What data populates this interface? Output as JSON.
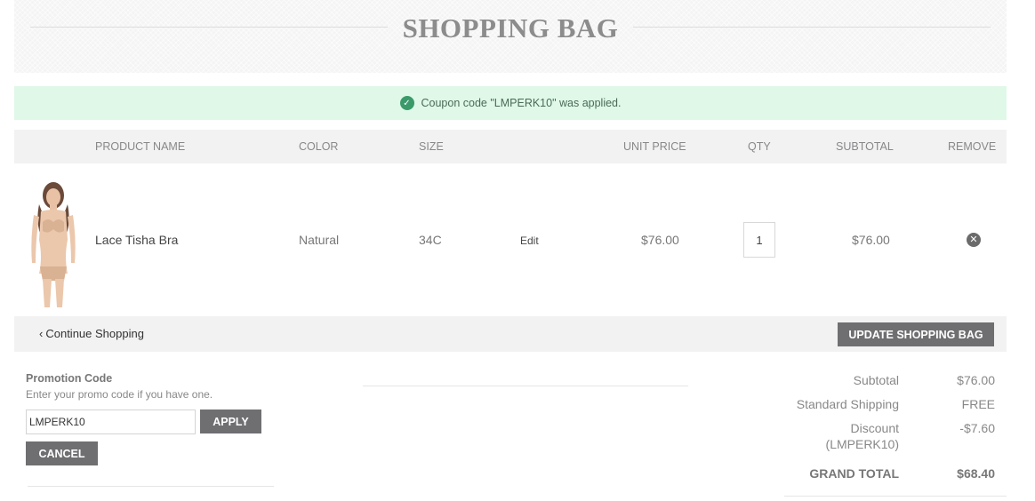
{
  "header": {
    "title": "SHOPPING BAG"
  },
  "notice": {
    "icon": "check-circle-icon",
    "text": "Coupon code \"LMPERK10\" was applied."
  },
  "table": {
    "columns": [
      "PRODUCT NAME",
      "COLOR",
      "SIZE",
      "UNIT PRICE",
      "QTY",
      "SUBTOTAL",
      "REMOVE"
    ],
    "items": [
      {
        "name": "Lace Tisha Bra",
        "color": "Natural",
        "size": "34C",
        "edit_label": "Edit",
        "unit_price": "$76.00",
        "qty": "1",
        "subtotal": "$76.00",
        "remove_icon": "close-circle-icon"
      }
    ]
  },
  "actions": {
    "continue_label": "Continue Shopping",
    "update_label": "UPDATE SHOPPING BAG"
  },
  "promo": {
    "title": "Promotion Code",
    "hint": "Enter your promo code if you have one.",
    "code_value": "LMPERK10",
    "apply_label": "APPLY",
    "cancel_label": "CANCEL"
  },
  "totals": {
    "subtotal_label": "Subtotal",
    "subtotal_value": "$76.00",
    "shipping_label": "Standard Shipping",
    "shipping_value": "FREE",
    "discount_label_line1": "Discount",
    "discount_label_line2": "(LMPERK10)",
    "discount_value": "-$7.60",
    "grand_label": "GRAND TOTAL",
    "grand_value": "$68.40"
  },
  "colors": {
    "notice_bg": "#dff8e8",
    "check_green": "#3a9a6a",
    "button_dark": "#6f6f72",
    "table_head_bg": "#f2f2f3"
  }
}
